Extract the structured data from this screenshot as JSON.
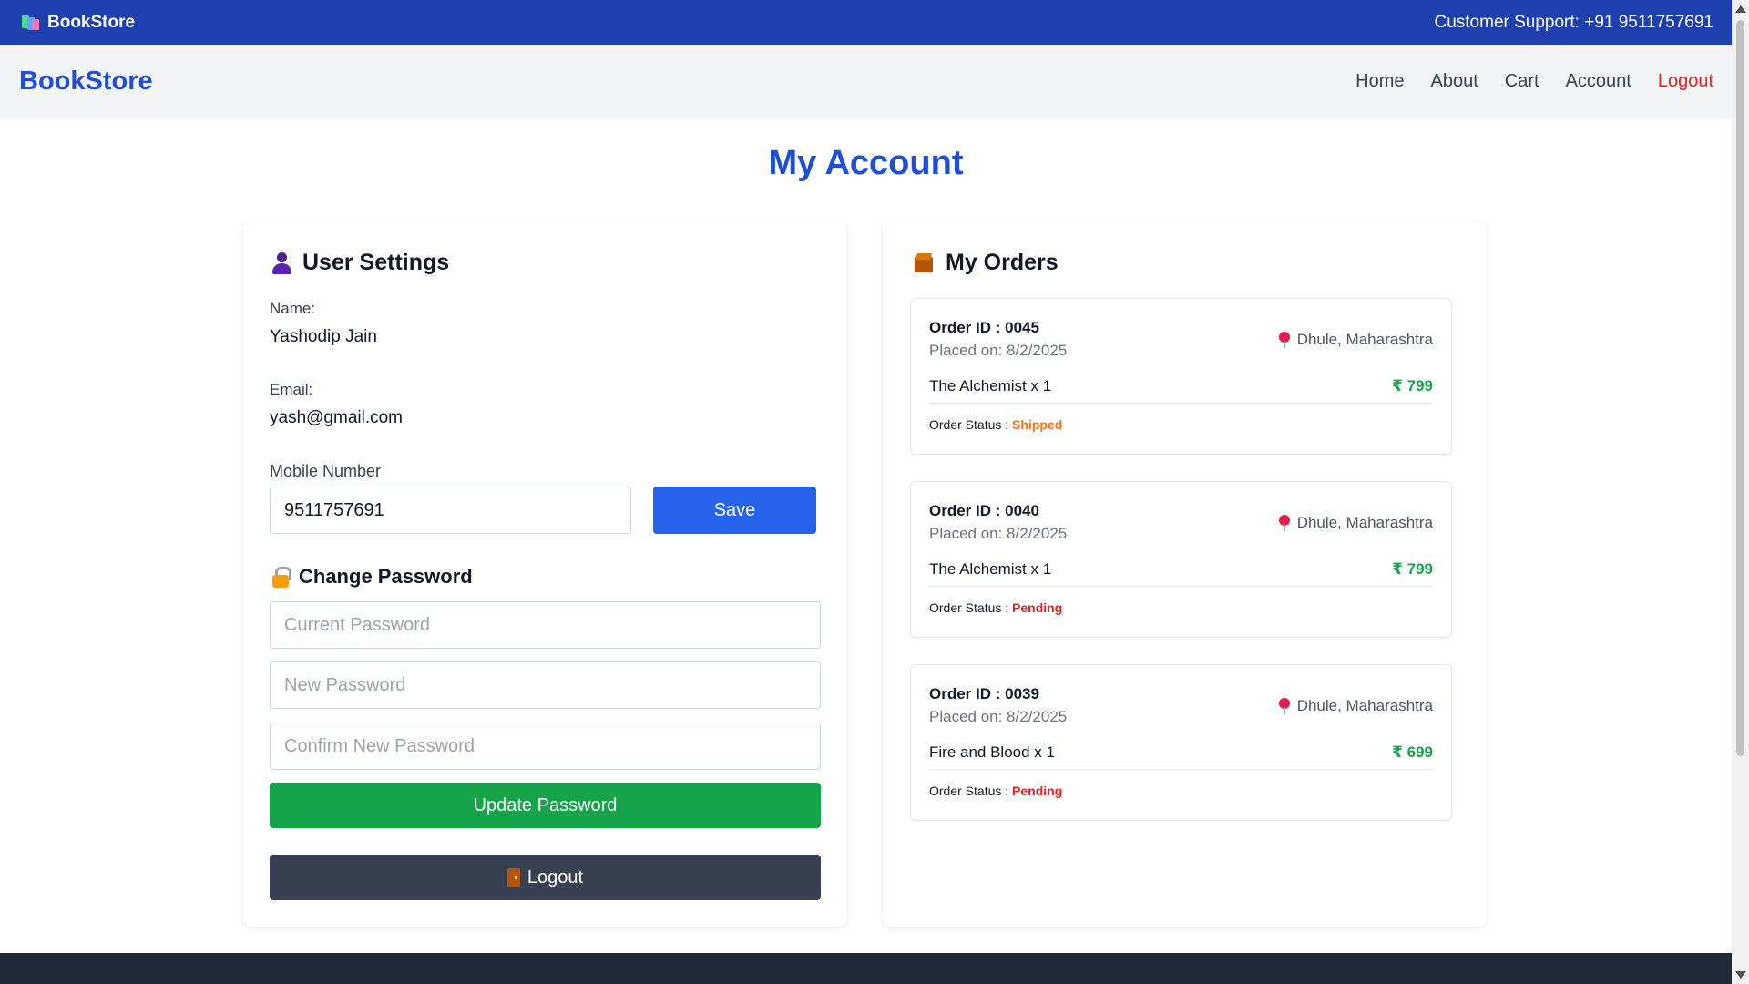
{
  "topbar": {
    "brand": "BookStore",
    "support": "Customer Support: +91 9511757691"
  },
  "navbar": {
    "logo": "BookStore",
    "links": [
      "Home",
      "About",
      "Cart",
      "Account",
      "Logout"
    ]
  },
  "page": {
    "title": "My Account"
  },
  "settings": {
    "heading": "User Settings",
    "name_label": "Name:",
    "name_value": "Yashodip Jain",
    "email_label": "Email:",
    "email_value": "yash@gmail.com",
    "mobile_label": "Mobile Number",
    "mobile_value": "9511757691",
    "save_label": "Save",
    "change_password_heading": "Change Password",
    "current_password_placeholder": "Current Password",
    "new_password_placeholder": "New Password",
    "confirm_password_placeholder": "Confirm New Password",
    "update_label": "Update Password",
    "logout_label": "Logout"
  },
  "orders": {
    "heading": "My Orders",
    "status_label": "Order Status :",
    "items": [
      {
        "order_id": "Order ID : 0045",
        "placed": "Placed on: 8/2/2025",
        "location": "Dhule, Maharashtra",
        "item": "The Alchemist x 1",
        "price": "₹ 799",
        "status": "Shipped"
      },
      {
        "order_id": "Order ID : 0040",
        "placed": "Placed on: 8/2/2025",
        "location": "Dhule, Maharashtra",
        "item": "The Alchemist x 1",
        "price": "₹ 799",
        "status": "Pending"
      },
      {
        "order_id": "Order ID : 0039",
        "placed": "Placed on: 8/2/2025",
        "location": "Dhule, Maharashtra",
        "item": "Fire and Blood x 1",
        "price": "₹ 699",
        "status": "Pending"
      }
    ]
  },
  "colors": {
    "topbar": "#1e40af",
    "accent": "#1d4ed8",
    "save_button": "#2563eb",
    "update_button": "#16a34a",
    "logout_button": "#374151",
    "status_shipped": "#f97316",
    "status_pending": "#dc2626",
    "price": "#16a34a"
  },
  "icons": {
    "brand": "books-icon",
    "user_settings": "user-icon",
    "orders": "package-icon",
    "change_password": "lock-icon",
    "logout": "door-icon",
    "location": "pin-icon"
  }
}
